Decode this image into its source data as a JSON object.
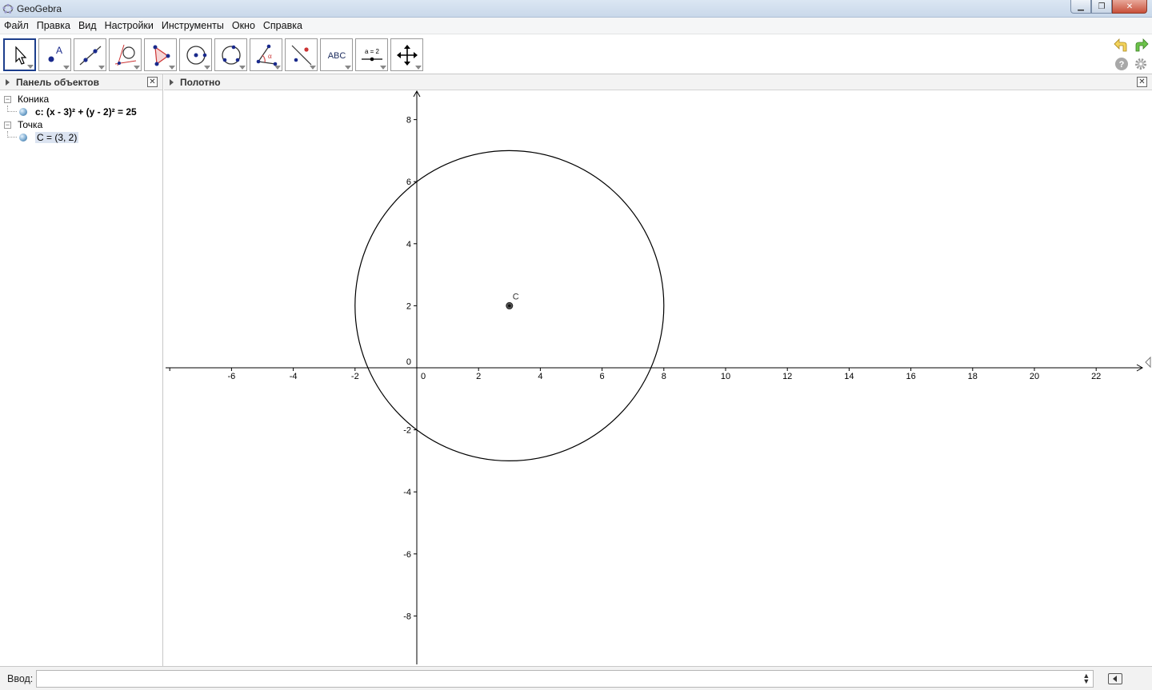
{
  "window": {
    "title": "GeoGebra"
  },
  "menu": [
    "Файл",
    "Правка",
    "Вид",
    "Настройки",
    "Инструменты",
    "Окно",
    "Справка"
  ],
  "toolbar": {
    "tools": [
      {
        "name": "move-tool",
        "active": true
      },
      {
        "name": "point-tool"
      },
      {
        "name": "line-tool"
      },
      {
        "name": "perpendicular-tool"
      },
      {
        "name": "polygon-tool"
      },
      {
        "name": "circle-tool"
      },
      {
        "name": "ellipse-tool"
      },
      {
        "name": "angle-tool"
      },
      {
        "name": "reflect-tool"
      },
      {
        "name": "text-tool",
        "label": "ABC"
      },
      {
        "name": "slider-tool",
        "label": "a = 2"
      },
      {
        "name": "move-view-tool"
      }
    ]
  },
  "algebra_panel": {
    "title": "Панель объектов",
    "categories": [
      {
        "label": "Коника",
        "items": [
          {
            "text": "c: (x - 3)² + (y - 2)² = 25",
            "bold": true
          }
        ]
      },
      {
        "label": "Точка",
        "items": [
          {
            "text": "C = (3, 2)",
            "selected": true
          }
        ]
      }
    ]
  },
  "graphics_panel": {
    "title": "Полотно",
    "x_ticks": [
      "-6",
      "-4",
      "-2",
      "0",
      "2",
      "4",
      "6",
      "8",
      "10",
      "12",
      "14",
      "16",
      "18",
      "20",
      "22"
    ],
    "y_ticks": [
      "8",
      "6",
      "4",
      "2",
      "0",
      "-2",
      "-4",
      "-6",
      "-8"
    ],
    "point_label": "C",
    "circle": {
      "center": [
        3,
        2
      ],
      "radius": 5
    },
    "point": [
      3,
      2
    ]
  },
  "input_bar": {
    "label": "Ввод:",
    "value": ""
  }
}
